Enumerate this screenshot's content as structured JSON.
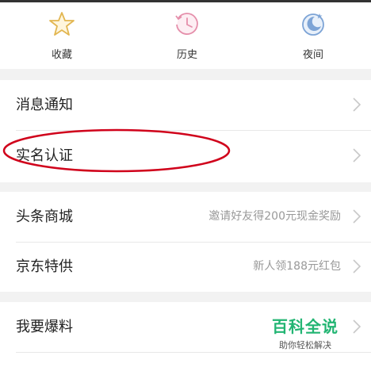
{
  "quick_actions": [
    {
      "label": "收藏",
      "icon": "star-icon"
    },
    {
      "label": "历史",
      "icon": "clock-history-icon"
    },
    {
      "label": "夜间",
      "icon": "moon-night-icon"
    }
  ],
  "section1": {
    "rows": [
      {
        "label": "消息通知"
      },
      {
        "label": "实名认证"
      }
    ]
  },
  "section2": {
    "rows": [
      {
        "label": "头条商城",
        "hint": "邀请好友得200元现金奖励"
      },
      {
        "label": "京东特供",
        "hint": "新人领188元红包"
      }
    ]
  },
  "section3": {
    "rows": [
      {
        "label": "我要爆料"
      }
    ]
  },
  "watermark": {
    "title": "百科全说",
    "subtitle": "助你轻松解决"
  },
  "colors": {
    "annotation": "#d0021b",
    "watermark": "#22b573"
  }
}
